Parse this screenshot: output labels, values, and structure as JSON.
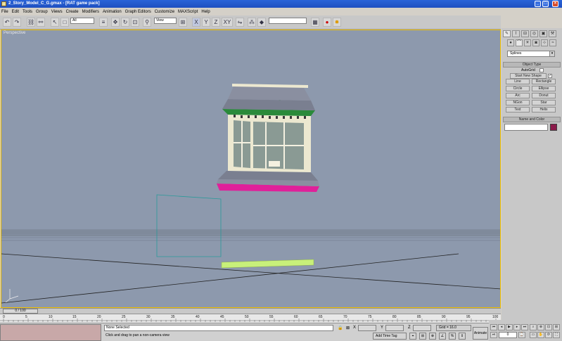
{
  "window": {
    "title": "2_Story_Model_C_G.gmax - [RAT game pack]",
    "min": "_",
    "max": "□",
    "close": "×"
  },
  "menu": [
    "File",
    "Edit",
    "Tools",
    "Group",
    "Views",
    "Create",
    "Modifiers",
    "Animation",
    "Graph Editors",
    "Customize",
    "MAXScript",
    "Help"
  ],
  "toolbar": {
    "selection_filter": "All",
    "coord_system": "View",
    "named_selection": ""
  },
  "viewport": {
    "label": "Perspective"
  },
  "command_panel": {
    "category": "Splines",
    "object_type_title": "Object Type",
    "autogrid": "AutoGrid",
    "start_new_shape": "Start New Shape",
    "buttons": [
      "Line",
      "Rectangle",
      "Circle",
      "Ellipse",
      "Arc",
      "Donut",
      "NGon",
      "Star",
      "Text",
      "Helix"
    ],
    "name_color_title": "Name and Color",
    "object_color": "#8b1a4a"
  },
  "timeline": {
    "frame_display": "0 / 100",
    "ticks": [
      "0",
      "5",
      "10",
      "15",
      "20",
      "25",
      "30",
      "35",
      "40",
      "45",
      "50",
      "55",
      "60",
      "65",
      "70",
      "75",
      "80",
      "85",
      "90",
      "95",
      "100"
    ]
  },
  "status": {
    "selection": "None Selected",
    "prompt": "Click and drag to pan a non-camera view",
    "x_label": "X",
    "y_label": "Y",
    "z_label": "Z",
    "grid": "Grid = 16.0",
    "add_time_tag": "Add Time Tag",
    "animate": "Animate",
    "frame": "0"
  }
}
